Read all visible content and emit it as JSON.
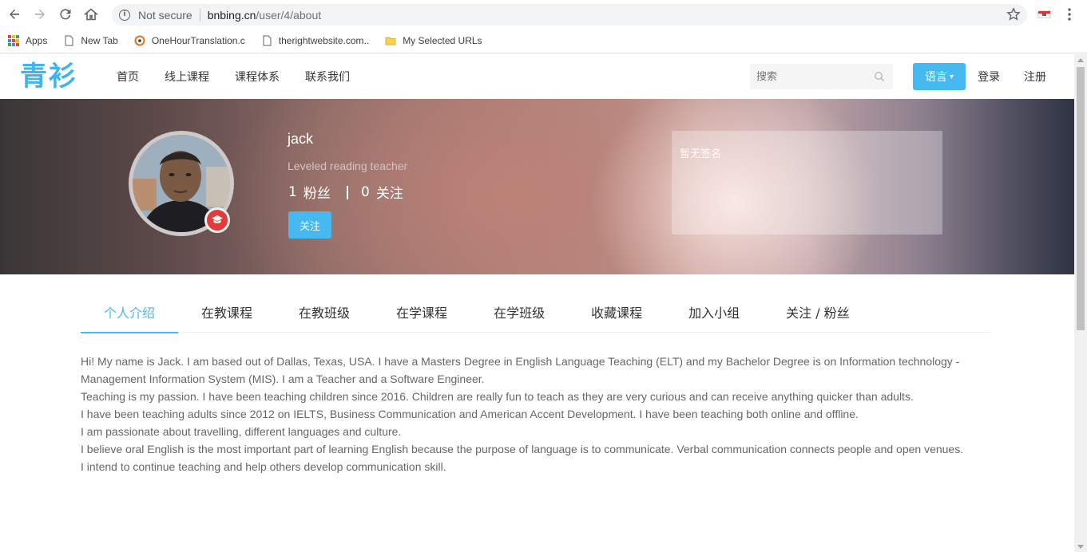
{
  "browser": {
    "status": "Not secure",
    "url_host": "bnbing.cn",
    "url_path": "/user/4/about",
    "bookmarks": [
      {
        "label": "Apps",
        "icon": "apps-grid-icon"
      },
      {
        "label": "New Tab",
        "icon": "page-icon"
      },
      {
        "label": "OneHourTranslation.c",
        "icon": "onehour-icon"
      },
      {
        "label": "therightwebsite.com..",
        "icon": "page-icon"
      },
      {
        "label": "My Selected URLs",
        "icon": "folder-icon"
      }
    ]
  },
  "header": {
    "logo": "青衫",
    "nav": [
      "首页",
      "线上课程",
      "课程体系",
      "联系我们"
    ],
    "search_placeholder": "搜索",
    "language_label": "语言",
    "login_label": "登录",
    "register_label": "注册"
  },
  "profile": {
    "name": "jack",
    "title": "Leveled reading teacher",
    "fans_count": "1",
    "fans_label": "粉丝",
    "following_count": "0",
    "following_label": "关注",
    "follow_button": "关注",
    "signature": "暂无签名"
  },
  "tabs": [
    {
      "label": "个人介绍",
      "active": true
    },
    {
      "label": "在教课程",
      "active": false
    },
    {
      "label": "在教班级",
      "active": false
    },
    {
      "label": "在学课程",
      "active": false
    },
    {
      "label": "在学班级",
      "active": false
    },
    {
      "label": "收藏课程",
      "active": false
    },
    {
      "label": "加入小组",
      "active": false
    },
    {
      "label": "关注 / 粉丝",
      "active": false
    }
  ],
  "about": [
    "Hi! My name is Jack. I am based out of Dallas, Texas, USA. I have a Masters Degree in English Language Teaching (ELT) and my Bachelor Degree is on Information technology - Management Information System (MIS). I am a Teacher and a Software Engineer.",
    "Teaching is my passion. I have been teaching children since 2016. Children are really fun to teach as they are very curious and can receive anything quicker than adults.",
    "I have been teaching adults since 2012 on IELTS, Business Communication and American Accent Development. I have been teaching both online and offline.",
    "I am passionate about travelling, different languages and culture.",
    "I believe oral English is the most important part of learning English because the purpose of language is to communicate. Verbal communication connects people and open venues.",
    "I intend to continue teaching and help others develop communication skill."
  ],
  "colors": {
    "accent": "#46b9f1",
    "logo": "#3fb4ee",
    "badge": "#e33b3b"
  }
}
